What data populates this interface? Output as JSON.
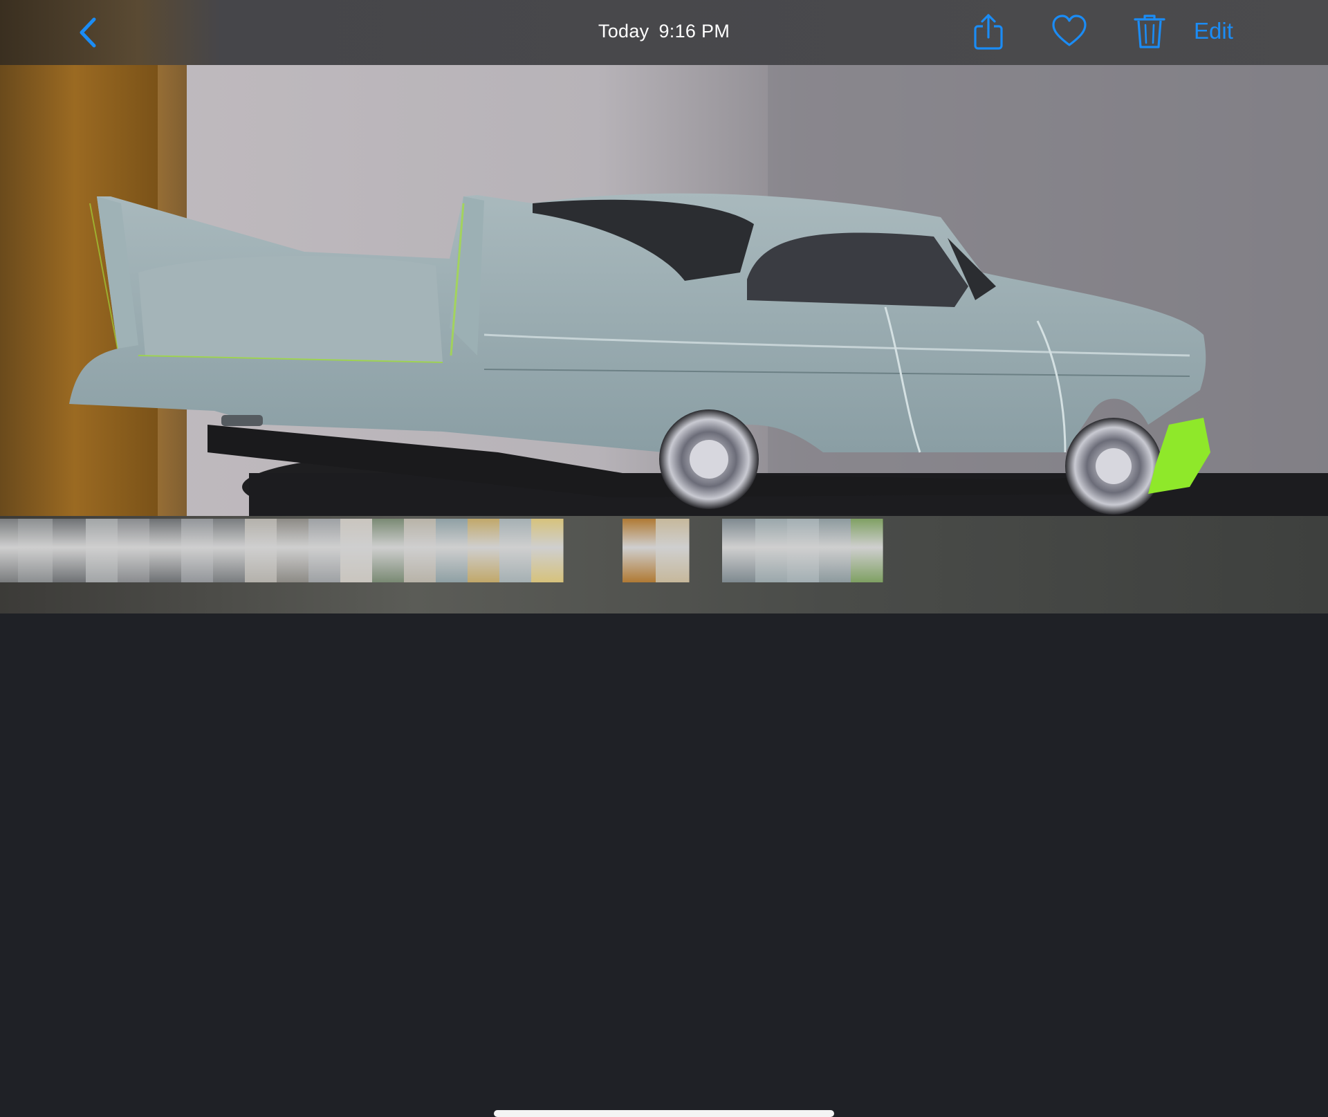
{
  "header": {
    "date_label": "Today",
    "time_label": "9:16 PM",
    "edit_label": "Edit",
    "icons": [
      "chevron-left-icon",
      "share-icon",
      "heart-icon",
      "trash-icon"
    ],
    "accent_color": "#1b8cf5"
  },
  "photo": {
    "subject": "model-car-image"
  },
  "filmstrip": {
    "groups": [
      {
        "count": 18
      },
      {
        "count": 2
      },
      {
        "count": 5
      }
    ]
  }
}
